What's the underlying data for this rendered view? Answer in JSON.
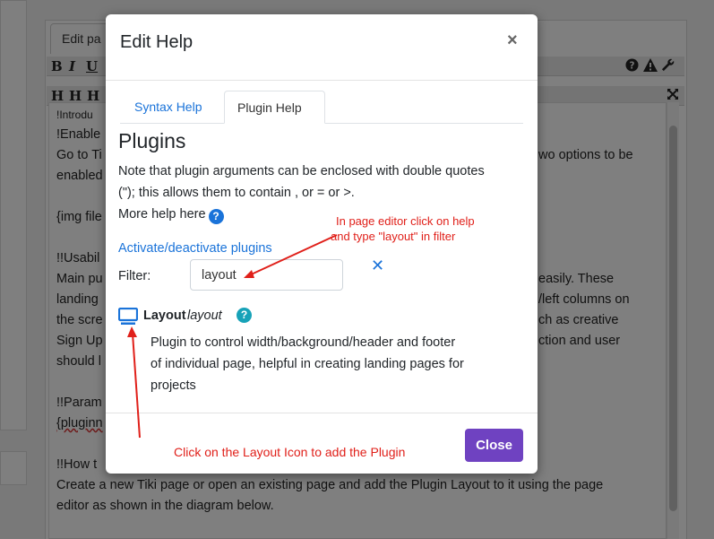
{
  "editor": {
    "tab_label": "Edit pa",
    "toolbar1": {
      "bold": "B",
      "italic": "I",
      "underline": "U"
    },
    "toolbar2": {
      "h1": "H",
      "h2": "H",
      "h3": "H"
    },
    "lines_left": [
      "!Introdu",
      "!Enable",
      "Go to Ti",
      "enabled",
      "{img file",
      "!!Usabil",
      "Main pu",
      "landing",
      "the scre",
      "Sign Up",
      "should l",
      "!!Param",
      "{pluginn",
      "!!How t"
    ],
    "lines_right": [
      "wo options to be",
      "easily. These",
      "/left columns on",
      "ch as creative",
      "ction and user"
    ],
    "bottom_line_1": "Create a new Tiki page or open an existing page and add the Plugin Layout to it using the page",
    "bottom_line_2": "editor as shown in the diagram below."
  },
  "modal": {
    "title": "Edit Help",
    "close_glyph": "×",
    "tabs": [
      {
        "label": "Syntax Help"
      },
      {
        "label": "Plugin Help"
      }
    ],
    "heading": "Plugins",
    "note_line1": "Note that plugin arguments can be enclosed with double quotes",
    "note_line2": "(\"); this allows them to contain , or = or >.",
    "more_help": "More help here",
    "activate_link": "Activate/deactivate plugins",
    "filter_label": "Filter:",
    "filter_value": "layout",
    "clear_glyph": "✕",
    "plugin": {
      "name": "Layout",
      "slug": "layout",
      "description": [
        "Plugin to control width/background/header and footer",
        "of individual page, helpful in creating landing pages for",
        "projects"
      ]
    },
    "close_button": "Close"
  },
  "annotations": {
    "filter_tip_line1": "In page editor click on help",
    "filter_tip_line2": "and type \"layout\" in filter",
    "icon_tip": "Click on the Layout Icon to add the Plugin"
  },
  "colors": {
    "link": "#1a73d9",
    "annotation": "#e0201a",
    "primary_button": "#6f42c1",
    "help_teal": "#17a2b8"
  },
  "icons": [
    "question-circle-icon",
    "warning-icon",
    "wrench-icon",
    "fullscreen-icon",
    "monitor-icon",
    "close-icon",
    "clear-icon"
  ]
}
